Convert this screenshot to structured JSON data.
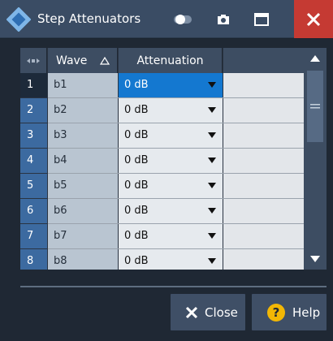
{
  "window": {
    "title": "Step Attenuators"
  },
  "table": {
    "headers": {
      "index": "",
      "wave": "Wave",
      "attenuation": "Attenuation"
    },
    "rows": [
      {
        "num": "1",
        "wave": "b1",
        "attenuation": "0 dB",
        "selected": true
      },
      {
        "num": "2",
        "wave": "b2",
        "attenuation": "0 dB"
      },
      {
        "num": "3",
        "wave": "b3",
        "attenuation": "0 dB"
      },
      {
        "num": "4",
        "wave": "b4",
        "attenuation": "0 dB"
      },
      {
        "num": "5",
        "wave": "b5",
        "attenuation": "0 dB"
      },
      {
        "num": "6",
        "wave": "b6",
        "attenuation": "0 dB"
      },
      {
        "num": "7",
        "wave": "b7",
        "attenuation": "0 dB"
      },
      {
        "num": "8",
        "wave": "b8",
        "attenuation": "0 dB"
      }
    ]
  },
  "buttons": {
    "close": "Close",
    "help": "Help"
  },
  "colors": {
    "accent": "#1478d0",
    "close_window": "#c53a33",
    "help_icon": "#f2b705"
  }
}
